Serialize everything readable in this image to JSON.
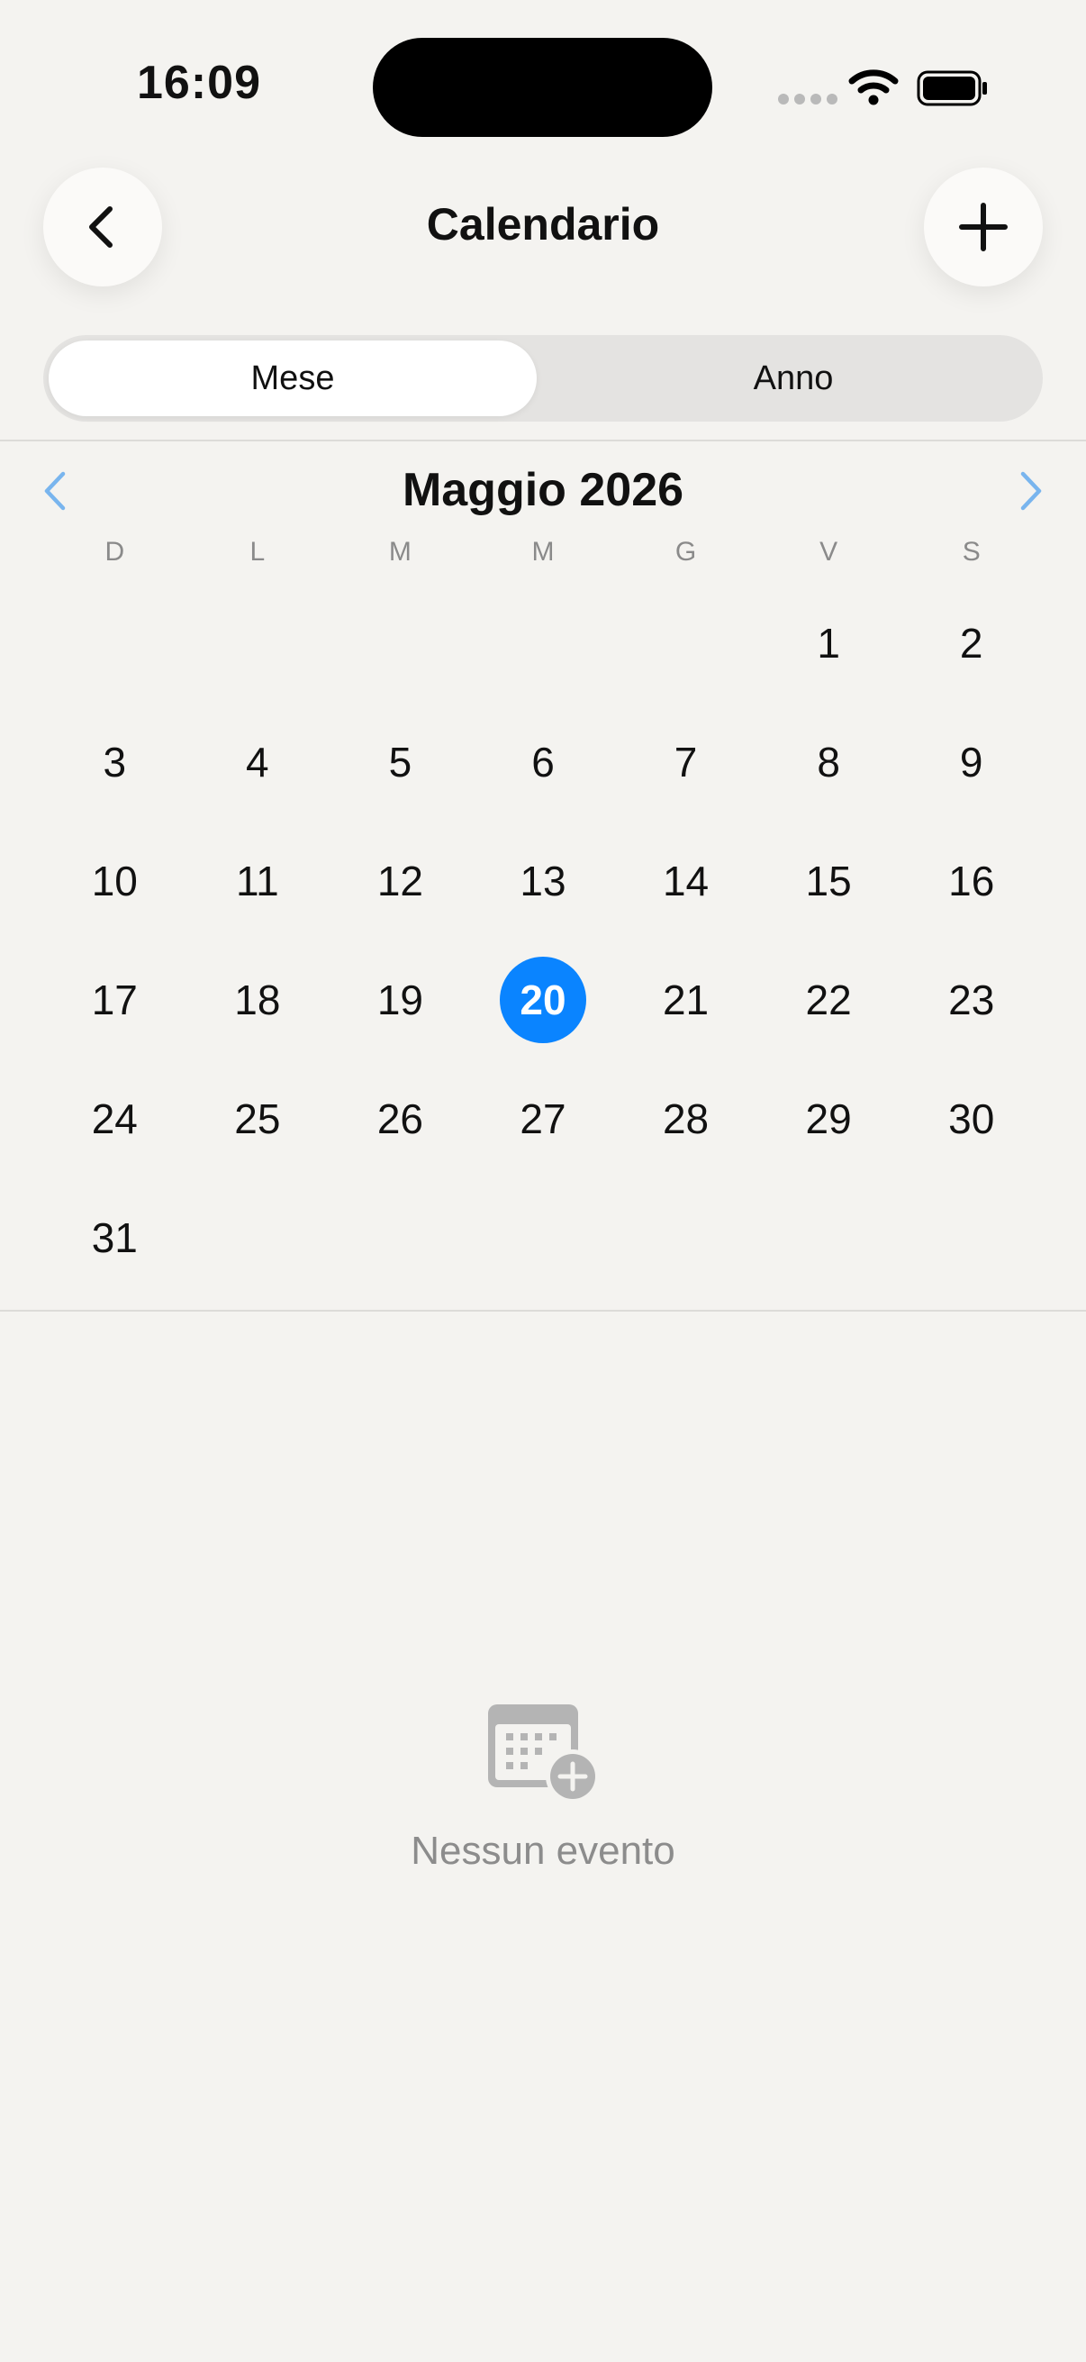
{
  "status_bar": {
    "time": "16:09"
  },
  "header": {
    "title": "Calendario",
    "back_icon": "chevron-left-icon",
    "add_icon": "plus-icon"
  },
  "view_mode": {
    "options": [
      "Mese",
      "Anno"
    ],
    "selected": "Mese"
  },
  "calendar": {
    "month_label": "Maggio 2026",
    "weekdays": [
      "D",
      "L",
      "M",
      "M",
      "G",
      "V",
      "S"
    ],
    "leading_blanks": 5,
    "days": [
      "1",
      "2",
      "3",
      "4",
      "5",
      "6",
      "7",
      "8",
      "9",
      "10",
      "11",
      "12",
      "13",
      "14",
      "15",
      "16",
      "17",
      "18",
      "19",
      "20",
      "21",
      "22",
      "23",
      "24",
      "25",
      "26",
      "27",
      "28",
      "29",
      "30",
      "31"
    ],
    "today": "20"
  },
  "events": {
    "empty_text": "Nessun evento",
    "empty_icon": "calendar-add-icon"
  },
  "colors": {
    "accent": "#0a84ff",
    "chevron": "#79b5ee",
    "background": "#f4f3f0"
  }
}
